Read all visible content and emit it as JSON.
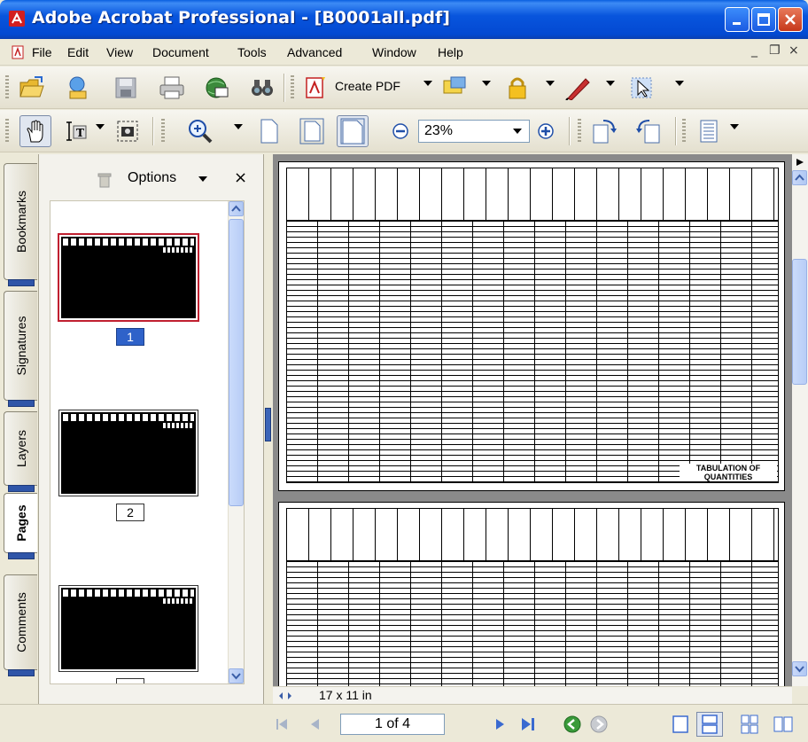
{
  "window": {
    "title": "Adobe Acrobat Professional - [B0001all.pdf]"
  },
  "menu": {
    "items": [
      "File",
      "Edit",
      "View",
      "Document",
      "Tools",
      "Advanced",
      "Window",
      "Help"
    ],
    "minimize": "_",
    "restore": "❐",
    "close": "×"
  },
  "toolbar1": {
    "create_pdf": "Create PDF"
  },
  "toolbar2": {
    "zoom_value": "23%"
  },
  "left_tabs": [
    "Bookmarks",
    "Signatures",
    "Layers",
    "Pages",
    "Comments"
  ],
  "pages_panel": {
    "options_label": "Options",
    "close_label": "×",
    "thumbnails": [
      {
        "label": "1",
        "selected": true
      },
      {
        "label": "2",
        "selected": false
      },
      {
        "label": "",
        "selected": false
      }
    ]
  },
  "document": {
    "page1_note": "TABULATION OF QUANTITIES",
    "page_size": "17 x 11 in"
  },
  "status": {
    "page_indicator": "1 of 4"
  },
  "colors": {
    "titlebar": "#0855dd",
    "selected_page": "#2f62c9",
    "selected_thumb_border": "#c02030"
  }
}
